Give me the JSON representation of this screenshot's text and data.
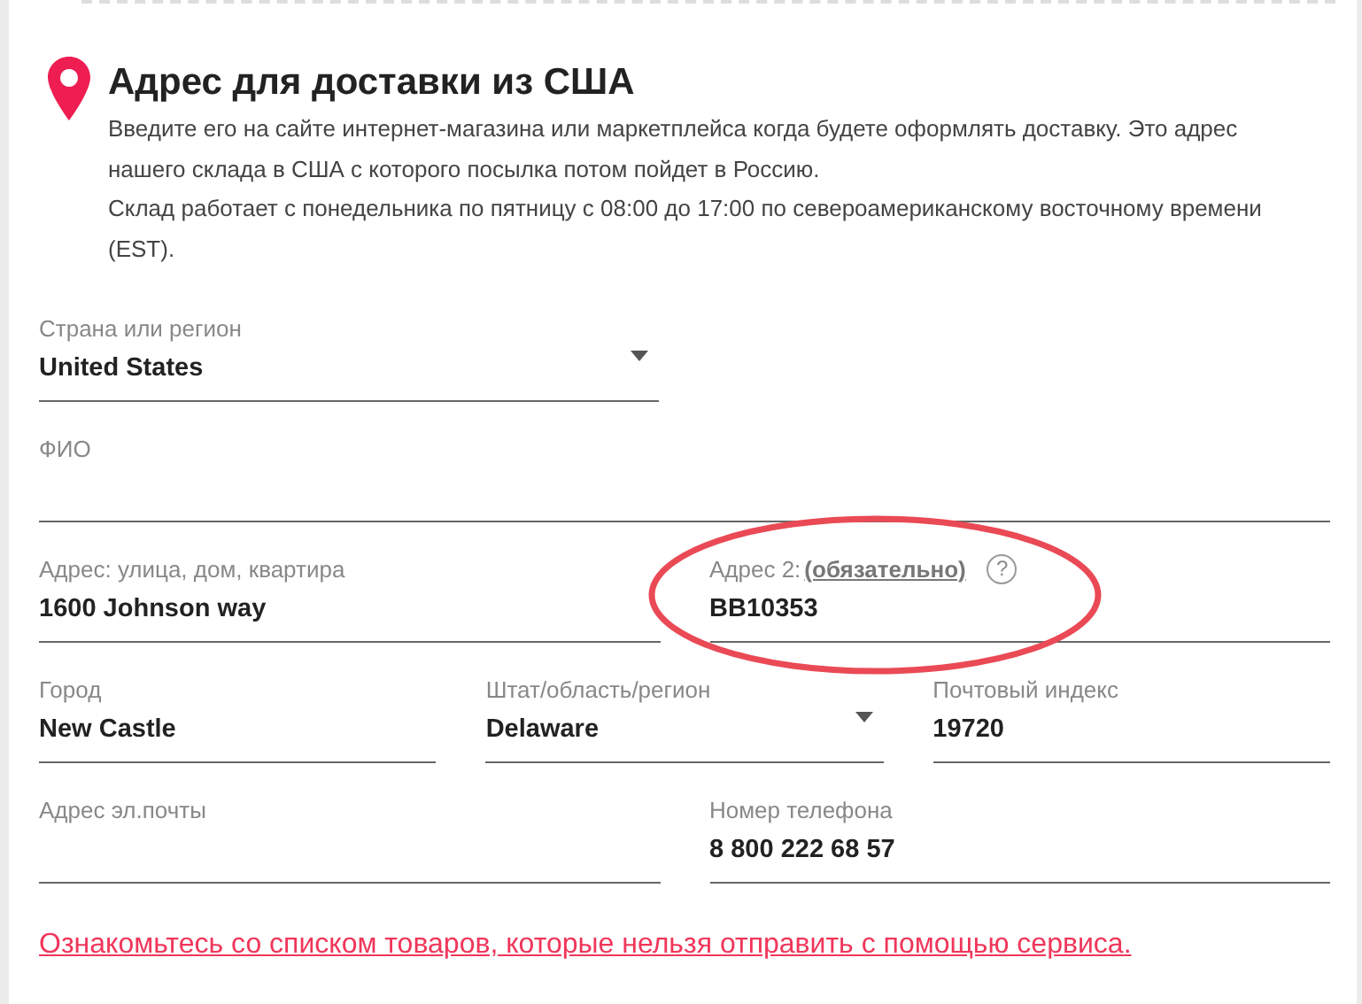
{
  "header": {
    "title": "Адрес для доставки из США",
    "paragraphs": [
      "Введите его на сайте интернет-магазина или маркетплейса когда будете оформлять доставку. Это адрес нашего склада в США с которого посылка потом пойдет в Россию.",
      "Склад работает с понедельника по пятницу с 08:00 до 17:00 по североамериканскому восточному времени (EST)."
    ]
  },
  "rows": [
    [
      {
        "kind": "select",
        "label": "Страна или регион",
        "value": "United States"
      }
    ],
    [
      {
        "kind": "text",
        "label": "ФИО"
      }
    ],
    [
      {
        "kind": "text",
        "label": "Адрес: улица, дом, квартира",
        "value": "1600 Johnson way"
      },
      {
        "kind": "text",
        "label": "Адрес 2:",
        "note": "(обязательно)",
        "help": "?",
        "value": "BB10353",
        "highlighted": true
      }
    ],
    [
      {
        "kind": "text",
        "label": "Город",
        "value": "New Castle"
      },
      {
        "kind": "select",
        "label": "Штат/область/регион",
        "value": "Delaware"
      },
      {
        "kind": "text",
        "label": "Почтовый индекс",
        "value": "19720"
      }
    ],
    [
      {
        "kind": "text",
        "label": "Адрес эл.почты"
      },
      {
        "kind": "text",
        "label": "Номер телефона",
        "value": "8 800 222 68 57"
      }
    ]
  ],
  "link": "Ознакомьтесь со списком товаров, которые нельзя отправить с помощью сервиса."
}
